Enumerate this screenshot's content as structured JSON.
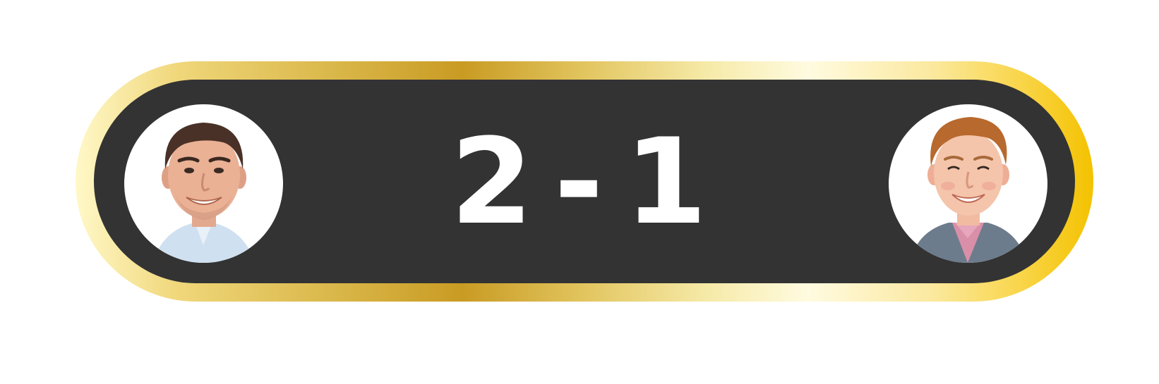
{
  "scoreboard": {
    "left_score": "2",
    "separator": "-",
    "right_score": "1"
  },
  "players": {
    "left": {
      "icon": "player-avatar-left"
    },
    "right": {
      "icon": "player-avatar-right"
    }
  },
  "colors": {
    "panel": "#333333",
    "score_text": "#ffffff",
    "gold_dark": "#c99b23",
    "gold_light": "#fffbe0",
    "gold_bright": "#f4c200"
  }
}
